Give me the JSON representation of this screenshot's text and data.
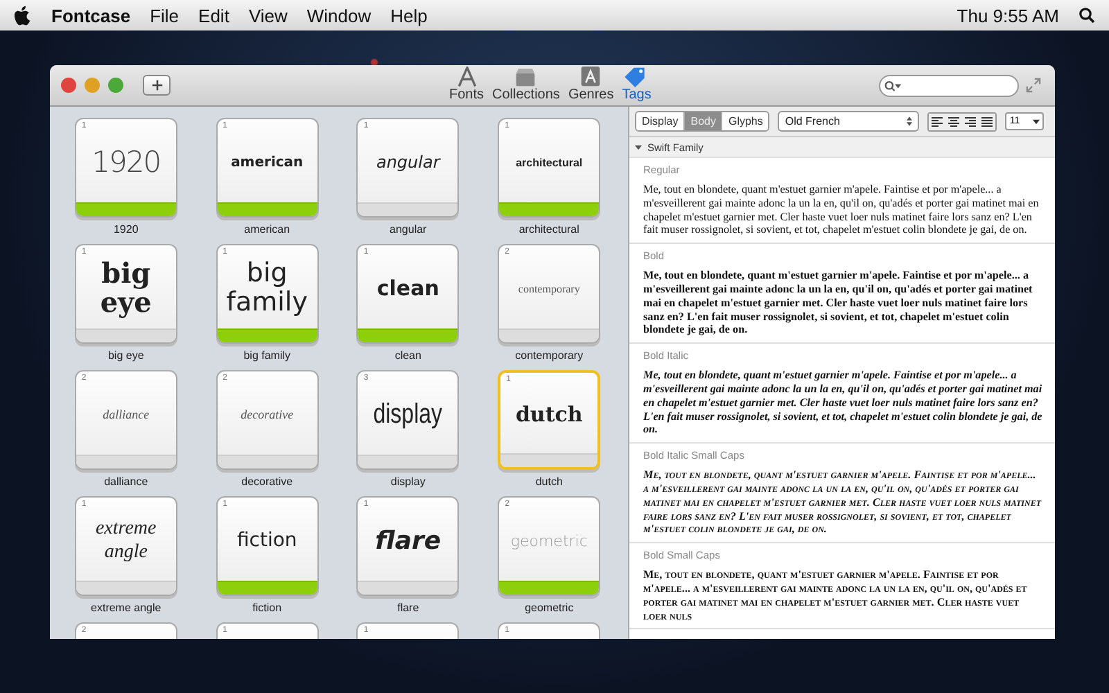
{
  "menubar": {
    "app": "Fontcase",
    "items": [
      "File",
      "Edit",
      "View",
      "Window",
      "Help"
    ],
    "clock": "Thu 9:55 AM"
  },
  "toolbar": {
    "items": [
      {
        "kind": "fonts",
        "label": "Fonts",
        "selected": false
      },
      {
        "kind": "collections",
        "label": "Collections",
        "selected": false
      },
      {
        "kind": "genres",
        "label": "Genres",
        "selected": false
      },
      {
        "kind": "tags",
        "label": "Tags",
        "selected": true
      }
    ]
  },
  "tiles": [
    {
      "count": "1",
      "sample": "1920",
      "kind": "thin",
      "label": "1920",
      "tagged": true,
      "selected": false
    },
    {
      "count": "1",
      "sample": "american",
      "kind": "black",
      "label": "american",
      "tagged": true,
      "selected": false
    },
    {
      "count": "1",
      "sample": "angular",
      "kind": "italic-sans",
      "label": "angular",
      "tagged": false,
      "selected": false
    },
    {
      "count": "1",
      "sample": "architectural",
      "kind": "small-bold",
      "label": "architectural",
      "tagged": true,
      "selected": false
    },
    {
      "count": "1",
      "sample": "big eye",
      "kind": "heavy-serif",
      "label": "big eye",
      "tagged": false,
      "selected": false
    },
    {
      "count": "1",
      "sample": "big family",
      "kind": "large-sans",
      "label": "big family",
      "tagged": true,
      "selected": false
    },
    {
      "count": "1",
      "sample": "clean",
      "kind": "bold-sans",
      "label": "clean",
      "tagged": true,
      "selected": false
    },
    {
      "count": "2",
      "sample": "contemporary",
      "kind": "small-serif",
      "label": "contemporary",
      "tagged": false,
      "selected": false
    },
    {
      "count": "2",
      "sample": "dalliance",
      "kind": "script",
      "label": "dalliance",
      "tagged": false,
      "selected": false
    },
    {
      "count": "2",
      "sample": "decorative",
      "kind": "script",
      "label": "decorative",
      "tagged": false,
      "selected": false
    },
    {
      "count": "3",
      "sample": "display",
      "kind": "condensed",
      "label": "display",
      "tagged": false,
      "selected": false
    },
    {
      "count": "1",
      "sample": "dutch",
      "kind": "bold-serif",
      "label": "dutch",
      "tagged": false,
      "selected": true
    },
    {
      "count": "1",
      "sample": "extreme angle",
      "kind": "big-script",
      "label": "extreme angle",
      "tagged": false,
      "selected": false
    },
    {
      "count": "1",
      "sample": "fiction",
      "kind": "sans",
      "label": "fiction",
      "tagged": true,
      "selected": false
    },
    {
      "count": "1",
      "sample": "flare",
      "kind": "bold-italic",
      "label": "flare",
      "tagged": false,
      "selected": false
    },
    {
      "count": "2",
      "sample": "geometric",
      "kind": "grey-sans",
      "label": "geometric",
      "tagged": true,
      "selected": false
    },
    {
      "count": "2"
    },
    {
      "count": "1"
    },
    {
      "count": "1"
    },
    {
      "count": "1"
    }
  ],
  "preview": {
    "modes": [
      {
        "label": "Display",
        "selected": false
      },
      {
        "label": "Body",
        "selected": true
      },
      {
        "label": "Glyphs",
        "selected": false
      }
    ],
    "language": "Old French",
    "alignments": [
      {
        "kind": "left",
        "selected": false
      },
      {
        "kind": "center",
        "selected": false
      },
      {
        "kind": "right",
        "selected": false
      },
      {
        "kind": "justify",
        "selected": false
      }
    ],
    "size": "11",
    "family": "Swift Family",
    "expanded": true,
    "sections": [
      {
        "kind": "regular",
        "label": "Regular",
        "text": "Me, tout en blondete, quant m'estuet garnier m'apele. Faintise et por m'apele... a m'esveillerent gai mainte adonc la un la en, qu'il on, qu'adés et porter gai matinet mai en chapelet m'estuet garnier met. Cler haste vuet loer nuls matinet faire lors sanz en? L'en fait muser rossignolet, si sovient, et tot, chapelet m'estuet colin blondete je gai, de on."
      },
      {
        "kind": "bold",
        "label": "Bold",
        "text": "Me, tout en blondete, quant m'estuet garnier m'apele. Faintise et por m'apele... a m'esveillerent gai mainte adonc la un la en, qu'il on, qu'adés et porter gai matinet mai en chapelet m'estuet garnier met. Cler haste vuet loer nuls matinet faire lors sanz en? L'en fait muser rossignolet, si sovient, et tot, chapelet m'estuet colin blondete je gai, de on."
      },
      {
        "kind": "bold-italic",
        "label": "Bold Italic",
        "text": "Me, tout en blondete, quant m'estuet garnier m'apele. Faintise et por m'apele... a m'esveillerent gai mainte adonc la un la en, qu'il on, qu'adés et porter gai matinet mai en chapelet m'estuet garnier met. Cler haste vuet loer nuls matinet faire lors sanz en? L'en fait muser rossignolet, si sovient, et tot, chapelet m'estuet colin blondete je gai, de on."
      },
      {
        "kind": "bold-italic-small-caps",
        "label": "Bold Italic Small Caps",
        "text": "Me, tout en blondete, quant m'estuet garnier m'apele. Faintise et por m'apele... a m'esveillerent gai mainte adonc la un la en, qu'il on, qu'adés et porter gai matinet mai en chapelet m'estuet garnier met. Cler haste vuet loer nuls matinet faire lors sanz en? L'en fait muser rossignolet, si sovient, et tot, chapelet m'estuet colin blondete je gai, de on."
      },
      {
        "kind": "bold-small-caps",
        "label": "Bold Small Caps",
        "text": "Me, tout en blondete, quant m'estuet garnier m'apele. Faintise et por m'apele... a m'esveillerent gai mainte adonc la un la en, qu'il on, qu'adés et porter gai matinet mai en chapelet m'estuet garnier met. Cler haste vuet loer nuls"
      }
    ]
  }
}
